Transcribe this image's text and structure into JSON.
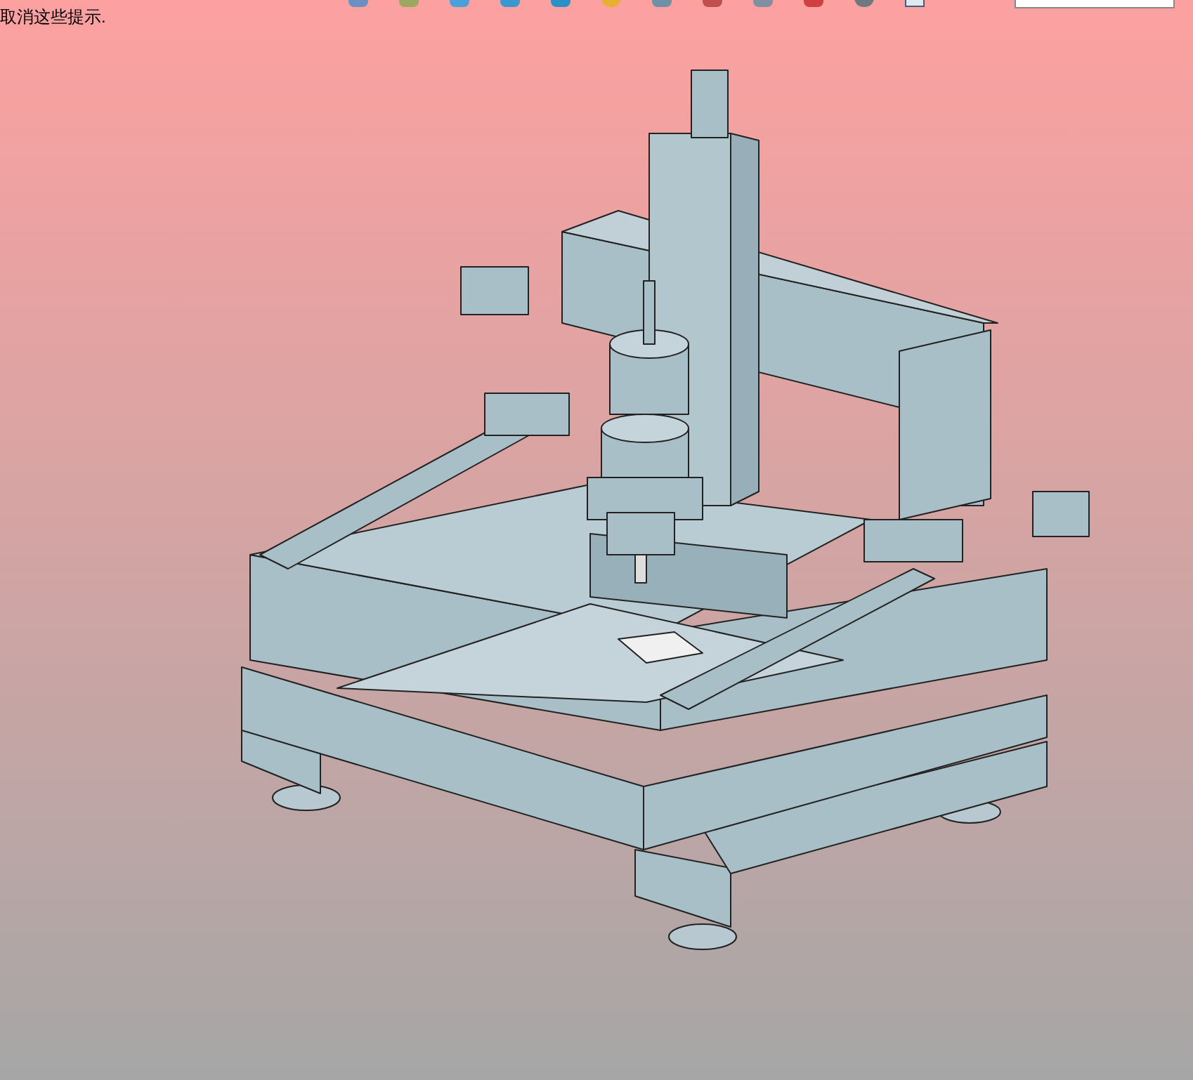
{
  "hint": {
    "text": "取消这些提示."
  }
}
